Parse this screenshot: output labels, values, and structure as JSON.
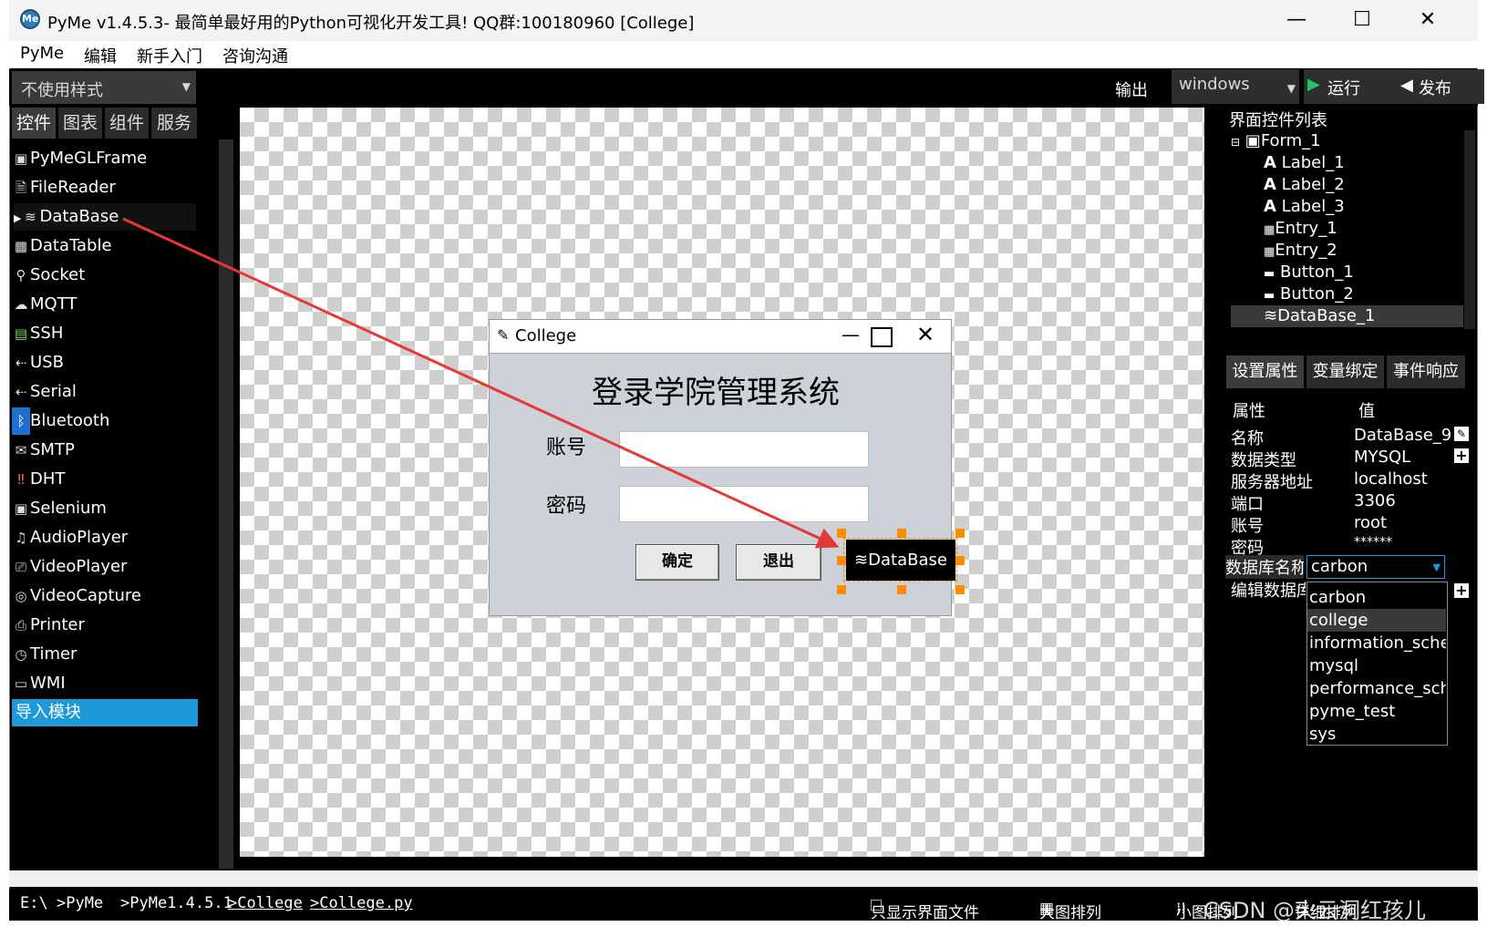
{
  "window": {
    "title": "PyMe v1.4.5.3- 最简单最好用的Python可视化开发工具! QQ群:100180960    [College]",
    "logo_text": "Me",
    "minimize": "—",
    "maximize": "☐",
    "close": "✕"
  },
  "menu": [
    "PyMe",
    "编辑",
    "新手入门",
    "咨询沟通"
  ],
  "toolbar": {
    "style_combo": "不使用样式",
    "output_label": "输出",
    "platform_combo": "windows",
    "run_label": "运行",
    "publish_label": "发布"
  },
  "left_tabs": [
    "控件",
    "图表",
    "组件",
    "服务"
  ],
  "left_items": [
    {
      "icon": "▣",
      "label": "PyMeGLFrame"
    },
    {
      "icon": "🗎",
      "label": "FileReader"
    },
    {
      "icon": "≋",
      "label": "DataBase"
    },
    {
      "icon": "▦",
      "label": "DataTable"
    },
    {
      "icon": "⚲",
      "label": "Socket"
    },
    {
      "icon": "☁",
      "label": "MQTT"
    },
    {
      "icon": "▤",
      "label": "SSH"
    },
    {
      "icon": "⇠",
      "label": "USB"
    },
    {
      "icon": "⇠",
      "label": "Serial"
    },
    {
      "icon": "ᛒ",
      "label": "Bluetooth"
    },
    {
      "icon": "✉",
      "label": "SMTP"
    },
    {
      "icon": "‼",
      "label": "DHT"
    },
    {
      "icon": "▣",
      "label": "Selenium"
    },
    {
      "icon": "♫",
      "label": "AudioPlayer"
    },
    {
      "icon": "⎚",
      "label": "VideoPlayer"
    },
    {
      "icon": "◎",
      "label": "VideoCapture"
    },
    {
      "icon": "⎙",
      "label": "Printer"
    },
    {
      "icon": "◷",
      "label": "Timer"
    },
    {
      "icon": "▭",
      "label": "WMI"
    },
    {
      "icon": "",
      "label": "导入模块"
    }
  ],
  "form": {
    "title": "College",
    "heading": "登录学院管理系统",
    "account_label": "账号",
    "password_label": "密码",
    "confirm_button": "确定",
    "exit_button": "退出",
    "db_widget": "DataBase"
  },
  "right_panel": {
    "title": "界面控件列表",
    "tree": [
      {
        "icon": "▣",
        "label": "Form_1",
        "prefix": "⊟"
      },
      {
        "icon": "A",
        "label": "Label_1"
      },
      {
        "icon": "A",
        "label": "Label_2"
      },
      {
        "icon": "A",
        "label": "Label_3"
      },
      {
        "icon": "▦",
        "label": "Entry_1"
      },
      {
        "icon": "▦",
        "label": "Entry_2"
      },
      {
        "icon": "▬",
        "label": "Button_1"
      },
      {
        "icon": "▬",
        "label": "Button_2"
      },
      {
        "icon": "≋",
        "label": "DataBase_1"
      }
    ],
    "tabs": [
      "设置属性",
      "变量绑定",
      "事件响应"
    ],
    "prop_header": {
      "name": "属性",
      "value": "值"
    },
    "props": [
      {
        "name": "名称",
        "value": "DataBase_9"
      },
      {
        "name": "数据类型",
        "value": "MYSQL"
      },
      {
        "name": "服务器地址",
        "value": "localhost"
      },
      {
        "name": "端口",
        "value": "3306"
      },
      {
        "name": "账号",
        "value": "root"
      },
      {
        "name": "密码",
        "value": "******"
      }
    ],
    "db_name_label": "数据库名称",
    "db_name_value": "carbon",
    "edit_db_label": "编辑数据库",
    "db_options": [
      "carbon",
      "college",
      "information_schema",
      "mysql",
      "performance_schema",
      "pyme_test",
      "sys"
    ]
  },
  "status": {
    "path_drive": "E:\\",
    "path_1": ">PyMe",
    "path_2": ">PyMe1.4.5.1",
    "path_3": ">College",
    "path_4": ">College.py",
    "only_ui": "只显示界面文件",
    "big_icons": "大图排列",
    "small_icons": "小图排列",
    "details": "详细排列",
    "watermark": "CSDN @火云洞红孩儿"
  },
  "colors": {
    "selected": "#1f9ad8",
    "handle": "#ff8c00",
    "arrow": "#e53935",
    "run_icon": "#22c55e"
  }
}
